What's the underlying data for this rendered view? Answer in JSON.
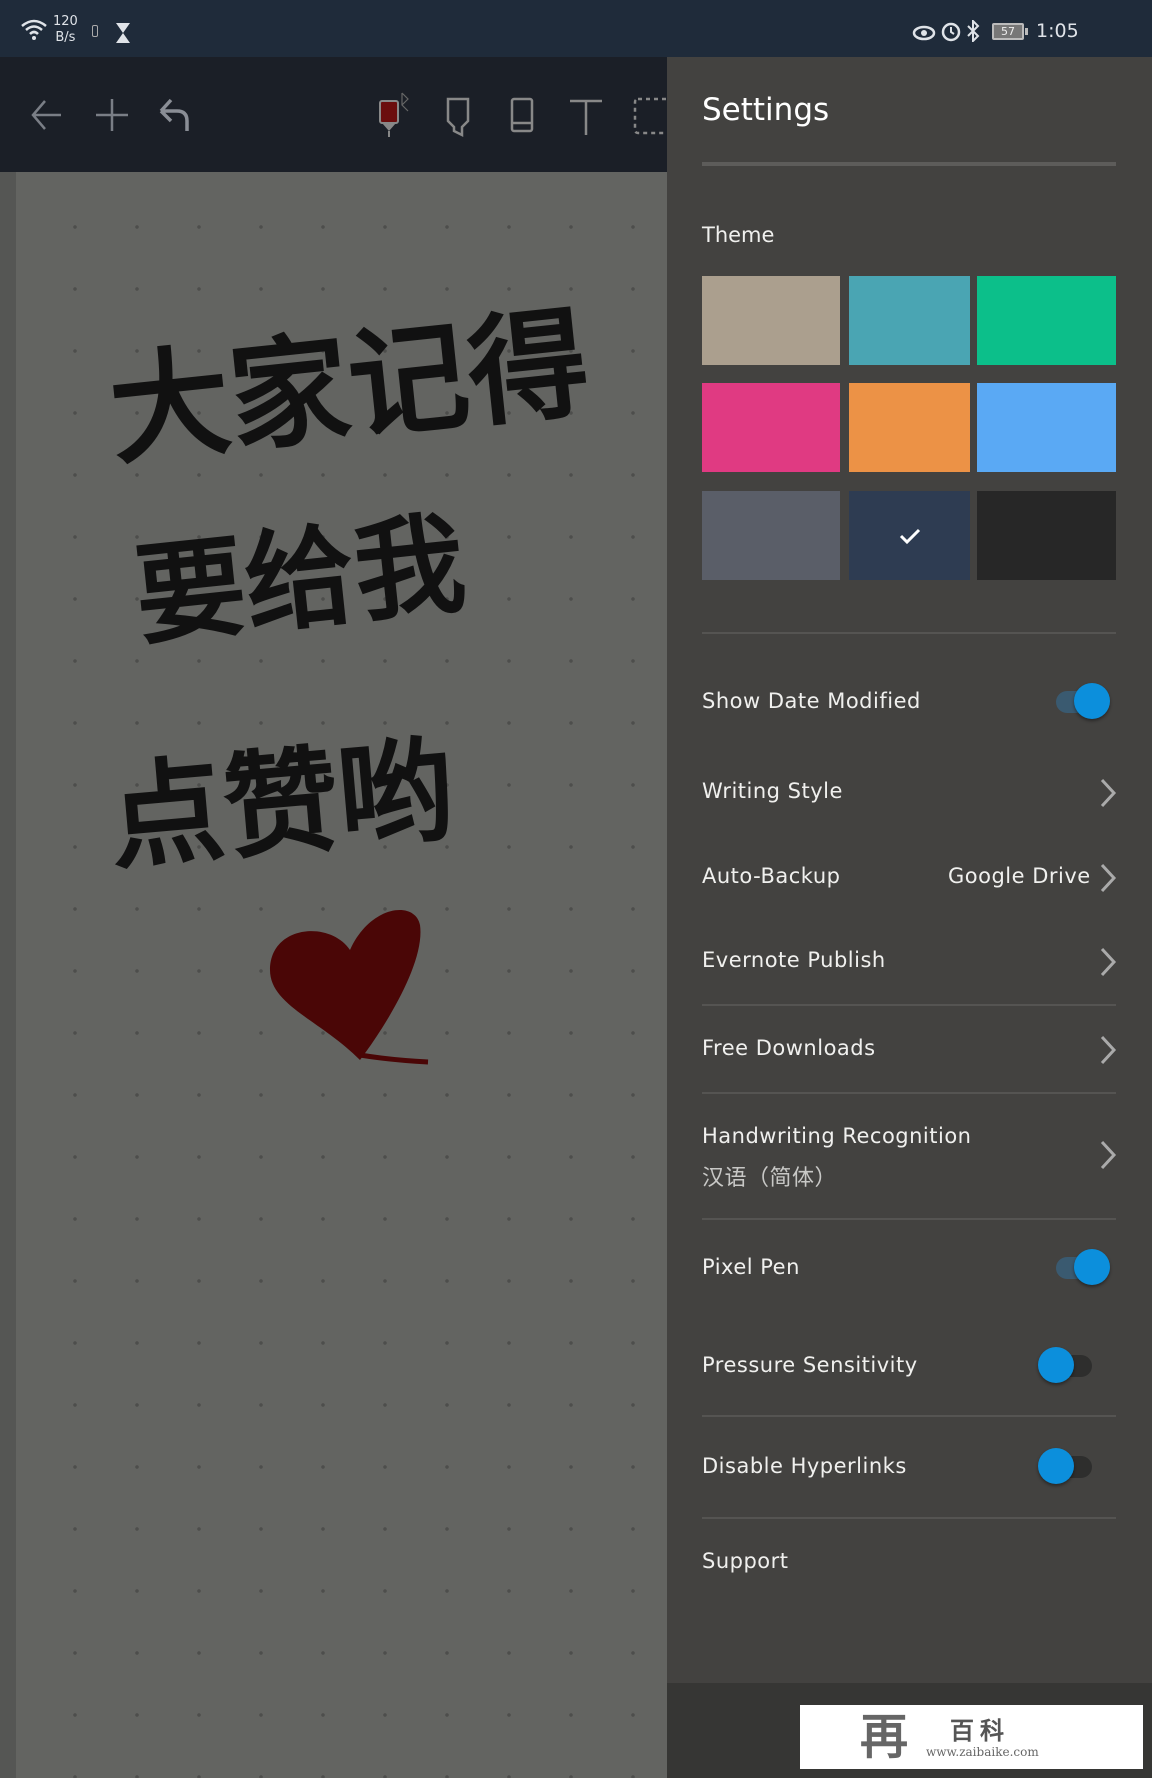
{
  "status_bar": {
    "net_speed_value": "120",
    "net_speed_unit": "B/s",
    "battery": "57",
    "time": "1:05"
  },
  "toolbar": {
    "icons": [
      "back-arrow-icon",
      "add-icon",
      "undo-icon",
      "pen-icon",
      "highlighter-icon",
      "eraser-icon",
      "text-icon",
      "selection-icon"
    ],
    "pen_color": "#6b0d0d"
  },
  "canvas": {
    "handwriting_lines": [
      "大家记得",
      "要给我",
      "点赞哟"
    ],
    "ink_color": "#111111",
    "heart_color": "#4a0606"
  },
  "settings": {
    "title": "Settings",
    "theme_label": "Theme",
    "themes": [
      {
        "color": "#ab9f8e",
        "selected": false
      },
      {
        "color": "#4aa5b3",
        "selected": false
      },
      {
        "color": "#0cbf8a",
        "selected": false
      },
      {
        "color": "#e03a82",
        "selected": false
      },
      {
        "color": "#ec9246",
        "selected": false
      },
      {
        "color": "#5aa9f4",
        "selected": false
      },
      {
        "color": "#5a5e68",
        "selected": false
      },
      {
        "color": "#2e3c52",
        "selected": true
      },
      {
        "color": "#272727",
        "selected": false
      }
    ],
    "items": {
      "show_date": {
        "label": "Show Date Modified",
        "on": true
      },
      "writing_style": {
        "label": "Writing Style"
      },
      "auto_backup": {
        "label": "Auto-Backup",
        "value": "Google Drive"
      },
      "evernote": {
        "label": "Evernote Publish"
      },
      "free_downloads": {
        "label": "Free Downloads"
      },
      "handwriting": {
        "label": "Handwriting Recognition",
        "value": "汉语（简体）"
      },
      "pixel_pen": {
        "label": "Pixel Pen",
        "on": true
      },
      "pressure": {
        "label": "Pressure Sensitivity",
        "on": false
      },
      "hyperlinks": {
        "label": "Disable Hyperlinks",
        "on": false
      },
      "support": {
        "label": "Support"
      }
    },
    "accent": "#0c8fdc"
  },
  "watermark": {
    "brand": "再百科",
    "url": "www.zaibaike.com"
  }
}
